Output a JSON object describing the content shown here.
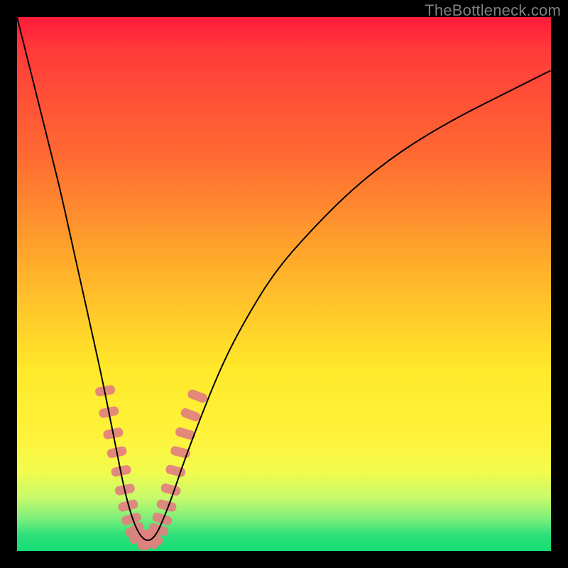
{
  "watermark": "TheBottleneck.com",
  "chart_data": {
    "type": "line",
    "title": "",
    "xlabel": "",
    "ylabel": "",
    "xlim": [
      0,
      100
    ],
    "ylim": [
      0,
      100
    ],
    "legend": false,
    "grid": false,
    "background_gradient": {
      "top": "#ff1a3a",
      "mid": "#ffe92a",
      "bottom": "#16dc74"
    },
    "series": [
      {
        "name": "bottleneck-curve",
        "color": "#000000",
        "x": [
          0,
          2,
          4,
          6,
          8,
          10,
          12,
          14,
          16,
          18,
          19,
          20,
          21,
          22,
          23,
          24,
          25,
          26,
          27,
          29,
          31,
          34,
          38,
          42,
          48,
          55,
          63,
          72,
          82,
          92,
          100
        ],
        "y": [
          100,
          92,
          84,
          76,
          68,
          59,
          50,
          41,
          32,
          22,
          17,
          12,
          8,
          5,
          3,
          2,
          2,
          3,
          5,
          10,
          16,
          24,
          34,
          42,
          52,
          60,
          68,
          75,
          81,
          86,
          90
        ]
      }
    ],
    "markers": [
      {
        "name": "highlight-left-branch",
        "shape": "rounded-rect",
        "color": "#e27f7f",
        "points": [
          {
            "x": 16.5,
            "y": 30
          },
          {
            "x": 17.2,
            "y": 26
          },
          {
            "x": 18.0,
            "y": 22
          },
          {
            "x": 18.7,
            "y": 18.5
          },
          {
            "x": 19.5,
            "y": 15
          },
          {
            "x": 20.2,
            "y": 11.5
          },
          {
            "x": 20.8,
            "y": 8.5
          },
          {
            "x": 21.4,
            "y": 6
          },
          {
            "x": 22.0,
            "y": 4
          },
          {
            "x": 22.8,
            "y": 2.7
          }
        ]
      },
      {
        "name": "highlight-trough",
        "shape": "rounded-rect",
        "color": "#e27f7f",
        "points": [
          {
            "x": 23.5,
            "y": 2
          },
          {
            "x": 24.2,
            "y": 2
          },
          {
            "x": 25.0,
            "y": 2
          },
          {
            "x": 25.8,
            "y": 2.7
          }
        ]
      },
      {
        "name": "highlight-right-branch",
        "shape": "rounded-rect",
        "color": "#e27f7f",
        "points": [
          {
            "x": 26.5,
            "y": 4
          },
          {
            "x": 27.2,
            "y": 6
          },
          {
            "x": 28.0,
            "y": 8.5
          },
          {
            "x": 28.8,
            "y": 11.5
          },
          {
            "x": 29.7,
            "y": 15
          },
          {
            "x": 30.6,
            "y": 18.5
          },
          {
            "x": 31.5,
            "y": 22
          },
          {
            "x": 32.5,
            "y": 25.5
          },
          {
            "x": 33.8,
            "y": 29
          }
        ]
      }
    ]
  }
}
